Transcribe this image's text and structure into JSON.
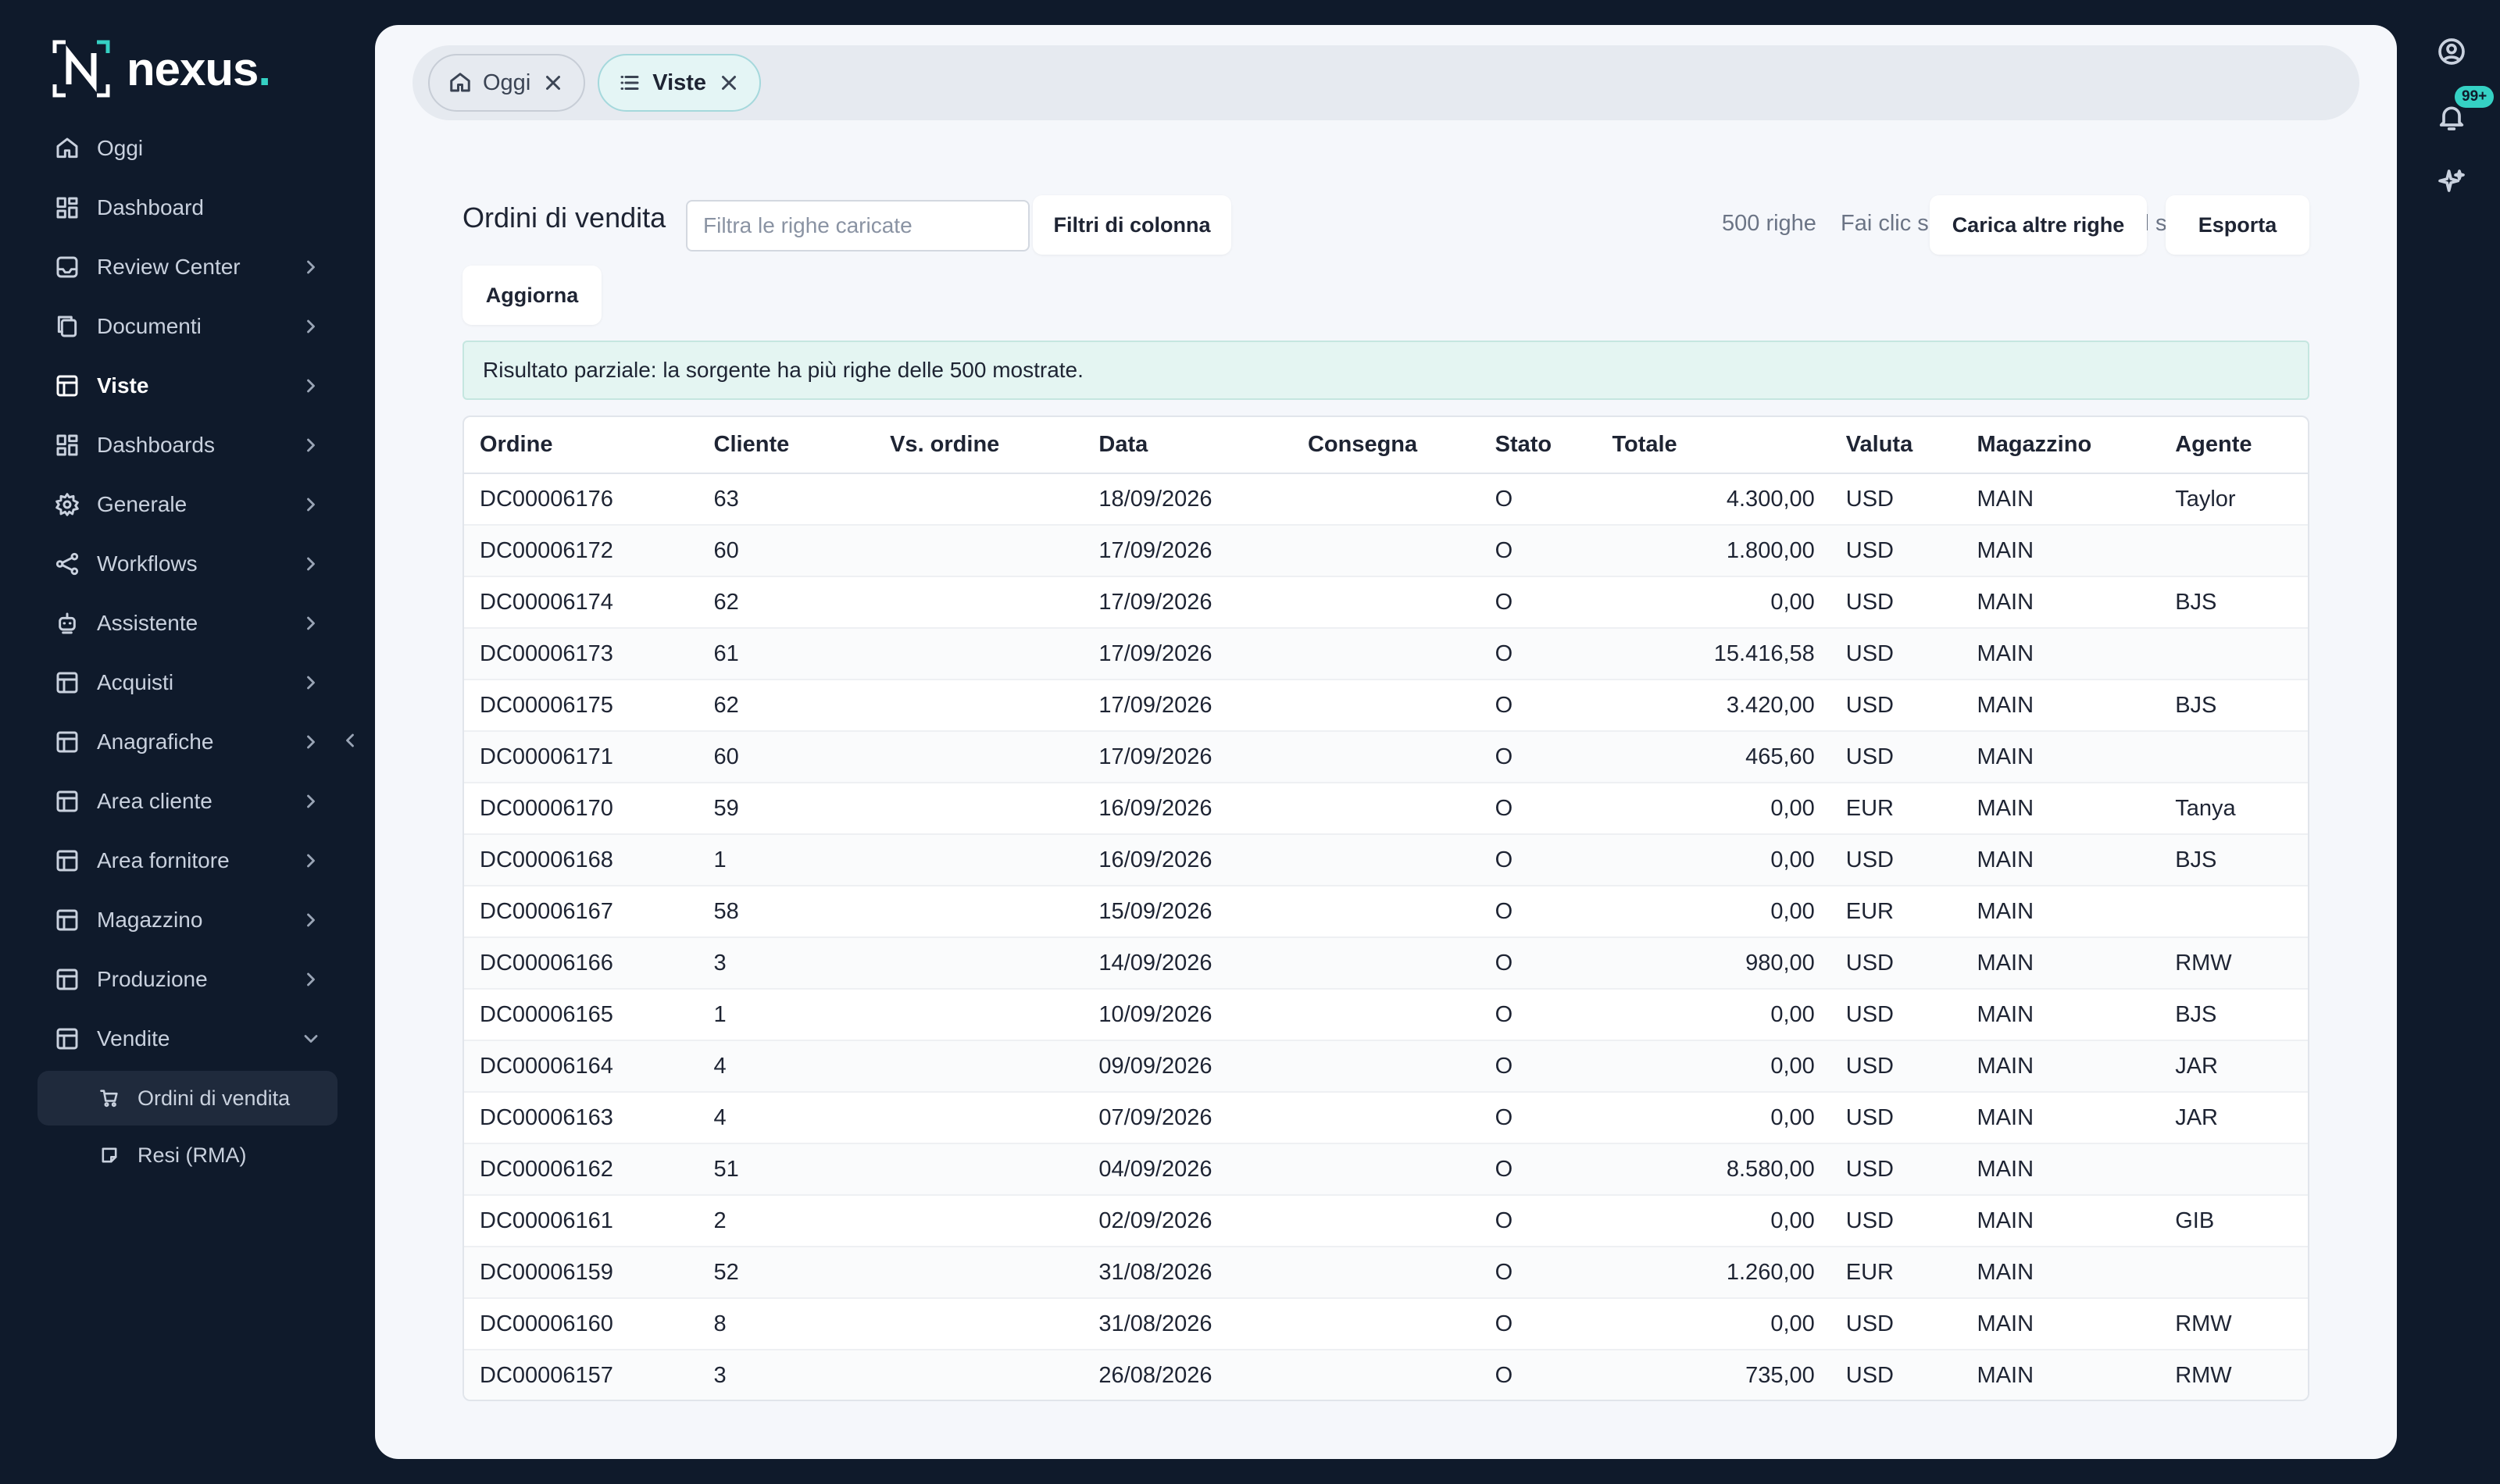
{
  "brand": {
    "name": "nexus",
    "dot": "."
  },
  "sidebar": {
    "items": [
      {
        "label": "Oggi",
        "icon": "home-icon",
        "chevron": false,
        "active": false
      },
      {
        "label": "Dashboard",
        "icon": "dashboard-icon",
        "chevron": false,
        "active": false
      },
      {
        "label": "Review Center",
        "icon": "inbox-icon",
        "chevron": true,
        "active": false
      },
      {
        "label": "Documenti",
        "icon": "documents-icon",
        "chevron": true,
        "active": false
      },
      {
        "label": "Viste",
        "icon": "table-icon",
        "chevron": true,
        "active": true
      },
      {
        "label": "Dashboards",
        "icon": "dashboard-icon",
        "chevron": true,
        "active": false
      },
      {
        "label": "Generale",
        "icon": "gear-icon",
        "chevron": true,
        "active": false
      },
      {
        "label": "Workflows",
        "icon": "workflow-icon",
        "chevron": true,
        "active": false
      },
      {
        "label": "Assistente",
        "icon": "robot-icon",
        "chevron": true,
        "active": false
      },
      {
        "label": "Acquisti",
        "icon": "table-icon",
        "chevron": true,
        "active": false
      },
      {
        "label": "Anagrafiche",
        "icon": "table-icon",
        "chevron": true,
        "active": false
      },
      {
        "label": "Area cliente",
        "icon": "table-icon",
        "chevron": true,
        "active": false
      },
      {
        "label": "Area fornitore",
        "icon": "table-icon",
        "chevron": true,
        "active": false
      },
      {
        "label": "Magazzino",
        "icon": "table-icon",
        "chevron": true,
        "active": false
      },
      {
        "label": "Produzione",
        "icon": "table-icon",
        "chevron": true,
        "active": false
      },
      {
        "label": "Vendite",
        "icon": "table-icon",
        "chevron": true,
        "active": false
      }
    ],
    "sub_items": [
      {
        "label": "Ordini di vendita",
        "icon": "cart-icon",
        "active": true
      },
      {
        "label": "Resi (RMA)",
        "icon": "return-icon",
        "active": false
      }
    ]
  },
  "rail": {
    "notification_badge": "99+"
  },
  "tabs": [
    {
      "label": "Oggi",
      "icon": "home-icon",
      "active": false
    },
    {
      "label": "Viste",
      "icon": "list-icon",
      "active": true
    }
  ],
  "toolbar": {
    "title": "Ordini di vendita",
    "filter_placeholder": "Filtra le righe caricate",
    "column_filters_label": "Filtri di colonna",
    "rows_count": "500 righe",
    "hint": "Fai clic su una riga per aprire il suo dettaglio.",
    "load_more_label": "Carica altre righe",
    "export_label": "Esporta",
    "refresh_label": "Aggiorna"
  },
  "notice": "Risultato parziale: la sorgente ha più righe delle 500 mostrate.",
  "table": {
    "columns": [
      "Ordine",
      "Cliente",
      "Vs. ordine",
      "Data",
      "Consegna",
      "Stato",
      "Totale",
      "Valuta",
      "Magazzino",
      "Agente"
    ],
    "rows": [
      [
        "DC00006176",
        "63",
        "",
        "18/09/2026",
        "",
        "O",
        "4.300,00",
        "USD",
        "MAIN",
        "Taylor"
      ],
      [
        "DC00006172",
        "60",
        "",
        "17/09/2026",
        "",
        "O",
        "1.800,00",
        "USD",
        "MAIN",
        ""
      ],
      [
        "DC00006174",
        "62",
        "",
        "17/09/2026",
        "",
        "O",
        "0,00",
        "USD",
        "MAIN",
        "BJS"
      ],
      [
        "DC00006173",
        "61",
        "",
        "17/09/2026",
        "",
        "O",
        "15.416,58",
        "USD",
        "MAIN",
        ""
      ],
      [
        "DC00006175",
        "62",
        "",
        "17/09/2026",
        "",
        "O",
        "3.420,00",
        "USD",
        "MAIN",
        "BJS"
      ],
      [
        "DC00006171",
        "60",
        "",
        "17/09/2026",
        "",
        "O",
        "465,60",
        "USD",
        "MAIN",
        ""
      ],
      [
        "DC00006170",
        "59",
        "",
        "16/09/2026",
        "",
        "O",
        "0,00",
        "EUR",
        "MAIN",
        "Tanya"
      ],
      [
        "DC00006168",
        "1",
        "",
        "16/09/2026",
        "",
        "O",
        "0,00",
        "USD",
        "MAIN",
        "BJS"
      ],
      [
        "DC00006167",
        "58",
        "",
        "15/09/2026",
        "",
        "O",
        "0,00",
        "EUR",
        "MAIN",
        ""
      ],
      [
        "DC00006166",
        "3",
        "",
        "14/09/2026",
        "",
        "O",
        "980,00",
        "USD",
        "MAIN",
        "RMW"
      ],
      [
        "DC00006165",
        "1",
        "",
        "10/09/2026",
        "",
        "O",
        "0,00",
        "USD",
        "MAIN",
        "BJS"
      ],
      [
        "DC00006164",
        "4",
        "",
        "09/09/2026",
        "",
        "O",
        "0,00",
        "USD",
        "MAIN",
        "JAR"
      ],
      [
        "DC00006163",
        "4",
        "",
        "07/09/2026",
        "",
        "O",
        "0,00",
        "USD",
        "MAIN",
        "JAR"
      ],
      [
        "DC00006162",
        "51",
        "",
        "04/09/2026",
        "",
        "O",
        "8.580,00",
        "USD",
        "MAIN",
        ""
      ],
      [
        "DC00006161",
        "2",
        "",
        "02/09/2026",
        "",
        "O",
        "0,00",
        "USD",
        "MAIN",
        "GIB"
      ],
      [
        "DC00006159",
        "52",
        "",
        "31/08/2026",
        "",
        "O",
        "1.260,00",
        "EUR",
        "MAIN",
        ""
      ],
      [
        "DC00006160",
        "8",
        "",
        "31/08/2026",
        "",
        "O",
        "0,00",
        "USD",
        "MAIN",
        "RMW"
      ],
      [
        "DC00006157",
        "3",
        "",
        "26/08/2026",
        "",
        "O",
        "735,00",
        "USD",
        "MAIN",
        "RMW"
      ]
    ]
  },
  "colors": {
    "sidebar_bg": "#0f1a2b",
    "accent": "#35d1c4",
    "panel_bg": "#f5f7fb"
  }
}
